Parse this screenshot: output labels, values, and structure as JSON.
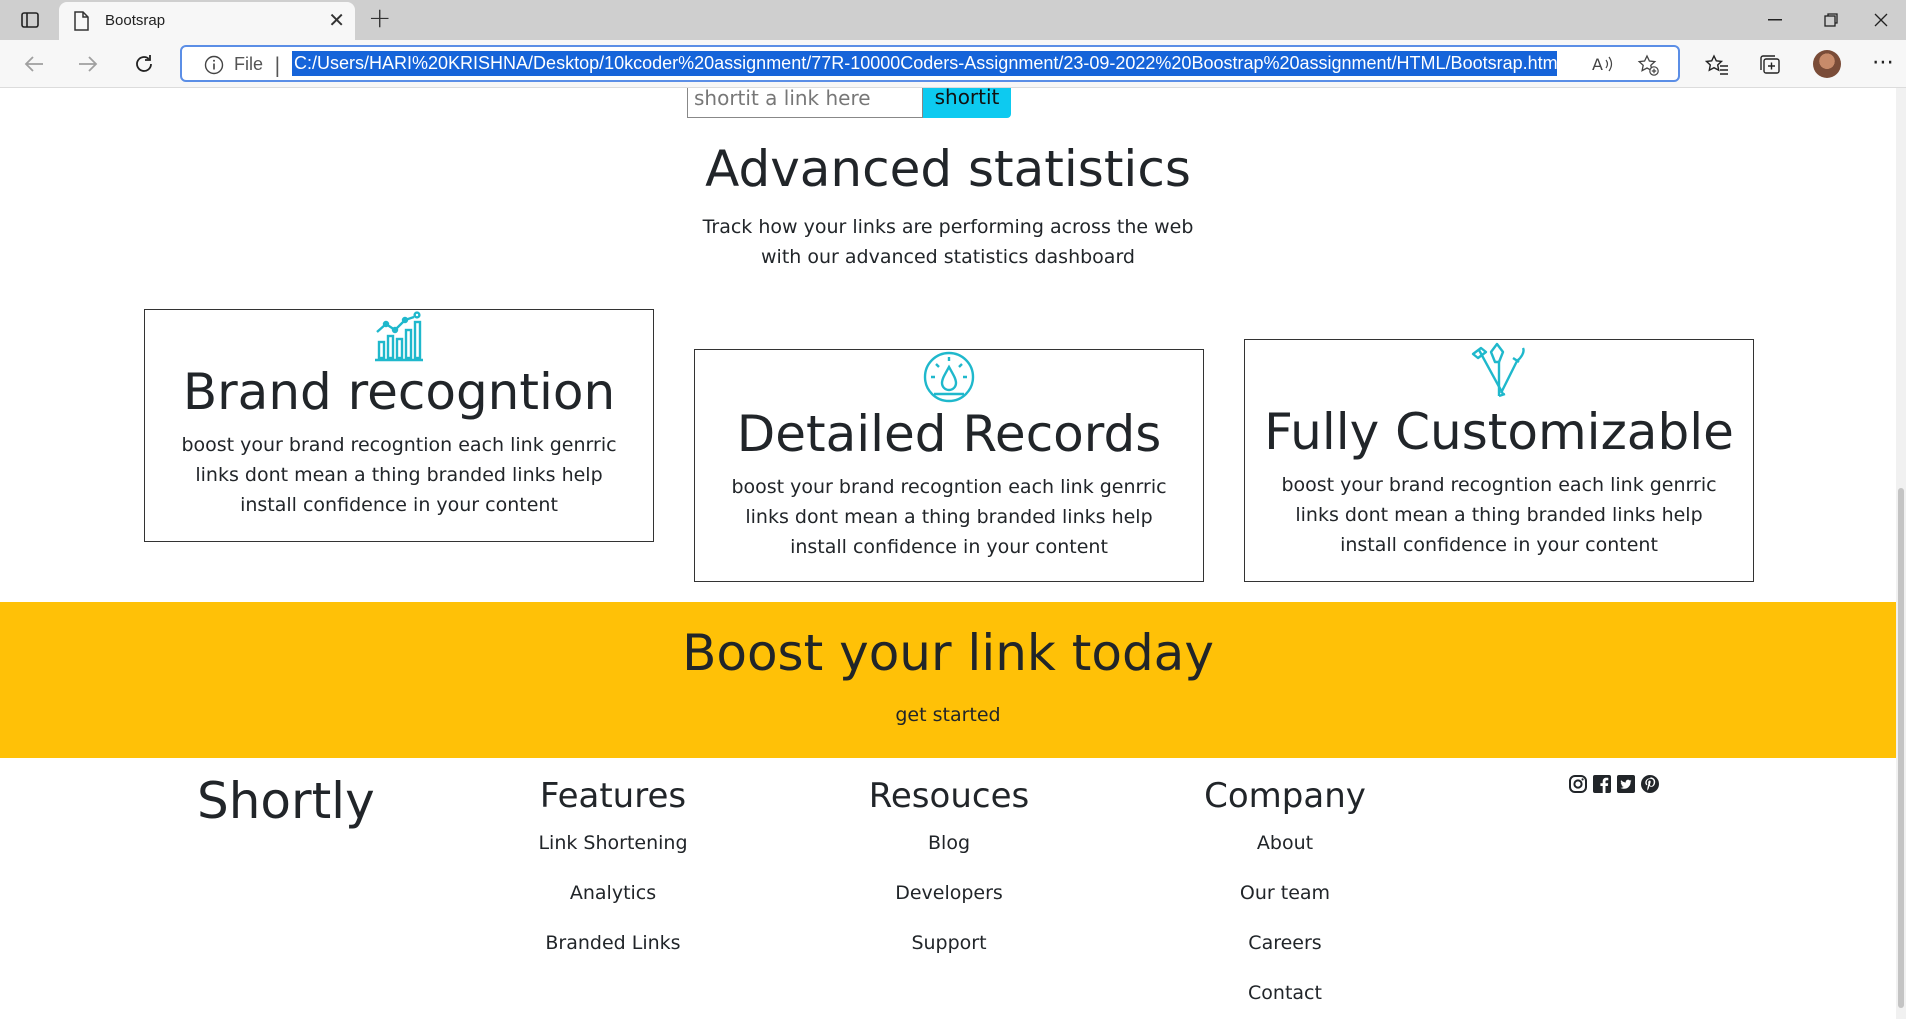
{
  "browser": {
    "tab_title": "Bootsrap",
    "file_label": "File",
    "url": "C:/Users/HARI%20KRISHNA/Desktop/10kcoder%20assignment/77R-10000Coders-Assignment/23-09-2022%20Boostrap%20assignment/HTML/Bootsrap.html"
  },
  "shorten": {
    "placeholder": "shortit a link here",
    "button_label": "shortit",
    "button_color": "#0dcaf0"
  },
  "stats": {
    "title": "Advanced statistics",
    "subtitle": "Track how your links are performing across the web with our advanced statistics dashboard"
  },
  "cards": [
    {
      "icon": "bar-chart-icon",
      "title": "Brand recogntion",
      "text": "boost your brand recogntion each link genrric links dont mean a thing branded links help install confidence in your content"
    },
    {
      "icon": "gauge-icon",
      "title": "Detailed Records",
      "text": "boost your brand recogntion each link genrric links dont mean a thing branded links help install confidence in your content"
    },
    {
      "icon": "brush-pen-icon",
      "title": "Fully Customizable",
      "text": "boost your brand recogntion each link genrric links dont mean a thing branded links help install confidence in your content"
    }
  ],
  "icon_color": "#1fb8cc",
  "boost": {
    "title": "Boost your link today",
    "link": "get started",
    "background": "#ffc107"
  },
  "footer": {
    "brand": "Shortly",
    "columns": [
      {
        "title": "Features",
        "items": [
          "Link Shortening",
          "Analytics",
          "Branded Links"
        ]
      },
      {
        "title": "Resouces",
        "items": [
          "Blog",
          "Developers",
          "Support"
        ]
      },
      {
        "title": "Company",
        "items": [
          "About",
          "Our team",
          "Careers",
          "Contact"
        ]
      }
    ],
    "socials": [
      "instagram-icon",
      "facebook-icon",
      "twitter-icon",
      "pinterest-icon"
    ]
  }
}
